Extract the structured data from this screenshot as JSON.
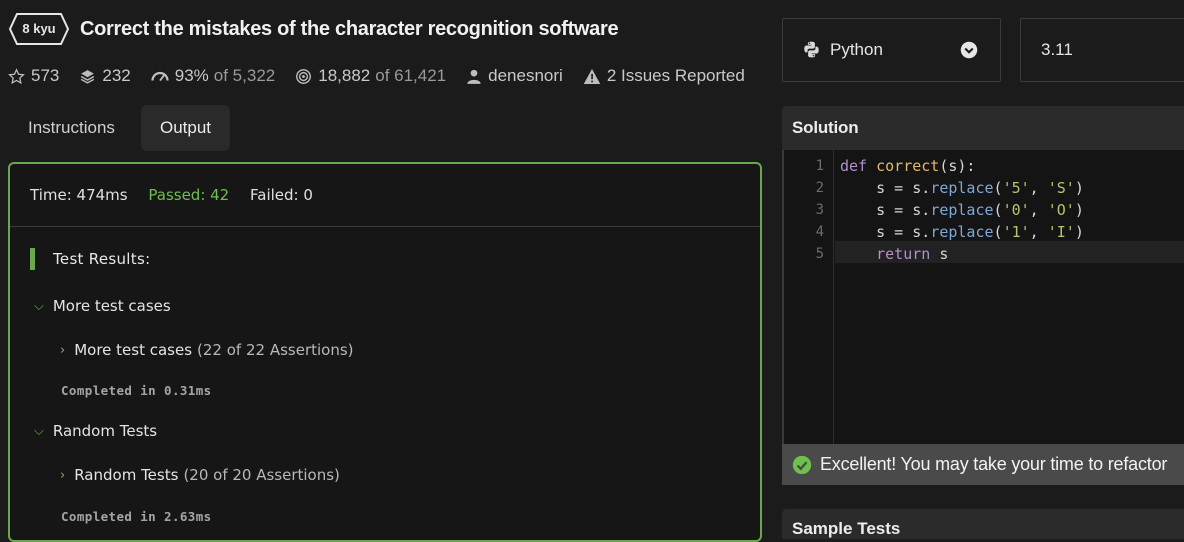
{
  "kata": {
    "rank": "8 kyu",
    "title": "Correct the mistakes of the character recognition software"
  },
  "stats": {
    "stars": "573",
    "collections": "232",
    "satisfaction": "93%",
    "satisfaction_of": "of 5,322",
    "completed": "18,882",
    "completed_of": "of 61,421",
    "author": "denesnori",
    "issues": "2 Issues Reported"
  },
  "tabs": [
    {
      "label": "Instructions",
      "active": false
    },
    {
      "label": "Output",
      "active": true
    }
  ],
  "output": {
    "time": "Time: 474ms",
    "passed": "Passed: 42",
    "failed": "Failed: 0",
    "results_title": "Test Results:",
    "groups": [
      {
        "label": "More test cases",
        "sub_label": "More test cases",
        "assertions": "(22 of 22 Assertions)",
        "completed": "Completed in 0.31ms"
      },
      {
        "label": "Random Tests",
        "sub_label": "Random Tests",
        "assertions": "(20 of 20 Assertions)",
        "completed": "Completed in 2.63ms"
      }
    ]
  },
  "language_select": {
    "value": "Python"
  },
  "version_select": {
    "value": "3.11"
  },
  "solution": {
    "title": "Solution",
    "line_numbers": [
      "1",
      "2",
      "3",
      "4",
      "5"
    ]
  },
  "success_message": "Excellent! You may take your time to refactor",
  "next_panel_title": "Sample Tests",
  "colors": {
    "accent_green": "#6aa84f",
    "background": "#1b1b1c"
  }
}
